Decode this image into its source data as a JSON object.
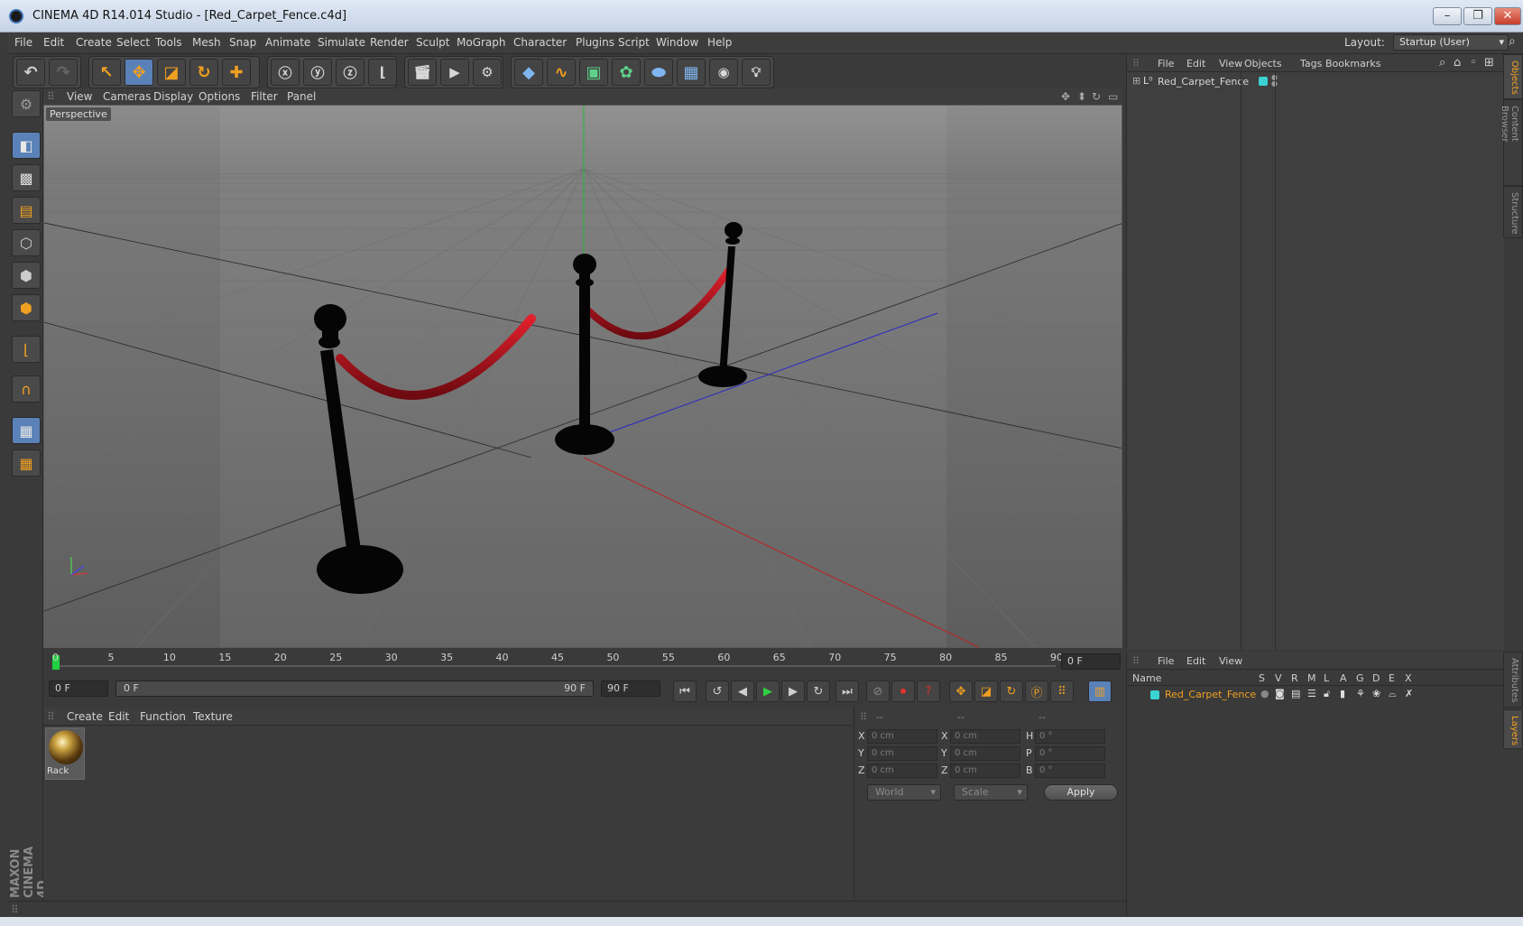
{
  "window": {
    "title": "CINEMA 4D R14.014 Studio - [Red_Carpet_Fence.c4d]"
  },
  "menubar": {
    "items": [
      "File",
      "Edit",
      "Create",
      "Select",
      "Tools",
      "Mesh",
      "Snap",
      "Animate",
      "Simulate",
      "Render",
      "Sculpt",
      "MoGraph",
      "Character",
      "Plugins",
      "Script",
      "Window",
      "Help"
    ],
    "layout_label": "Layout:",
    "layout_value": "Startup (User)"
  },
  "viewport": {
    "menu": [
      "View",
      "Cameras",
      "Display",
      "Options",
      "Filter",
      "Panel"
    ],
    "label": "Perspective"
  },
  "timeline": {
    "ticks": [
      "0",
      "5",
      "10",
      "15",
      "20",
      "25",
      "30",
      "35",
      "40",
      "45",
      "50",
      "55",
      "60",
      "65",
      "70",
      "75",
      "80",
      "85",
      "90"
    ],
    "current_frame": "0 F",
    "start_field": "0 F",
    "range_start": "0 F",
    "range_end": "90 F",
    "end_field": "90 F"
  },
  "materials": {
    "menu": [
      "Create",
      "Edit",
      "Function",
      "Texture"
    ],
    "items": [
      {
        "name": "Rack"
      }
    ]
  },
  "coordinates": {
    "headers": [
      "--",
      "--",
      "--"
    ],
    "rows": [
      {
        "a": "X",
        "av": "0 cm",
        "b": "X",
        "bv": "0 cm",
        "c": "H",
        "cv": "0 °"
      },
      {
        "a": "Y",
        "av": "0 cm",
        "b": "Y",
        "bv": "0 cm",
        "c": "P",
        "cv": "0 °"
      },
      {
        "a": "Z",
        "av": "0 cm",
        "b": "Z",
        "bv": "0 cm",
        "c": "B",
        "cv": "0 °"
      }
    ],
    "mode1": "World",
    "mode2": "Scale",
    "apply": "Apply"
  },
  "objects": {
    "menu": [
      "File",
      "Edit",
      "View",
      "Objects",
      "Tags",
      "Bookmarks"
    ],
    "items": [
      {
        "name": "Red_Carpet_Fence"
      }
    ]
  },
  "layers": {
    "menu": [
      "File",
      "Edit",
      "View"
    ],
    "columns": [
      "Name",
      "S",
      "V",
      "R",
      "M",
      "L",
      "A",
      "G",
      "D",
      "E",
      "X"
    ],
    "items": [
      {
        "name": "Red_Carpet_Fence"
      }
    ]
  },
  "sidetabs": {
    "top": [
      "Objects",
      "Content Browser",
      "Structure"
    ],
    "bottom": [
      "Attributes",
      "Layers"
    ]
  },
  "branding": {
    "logo": "MAXON CINEMA 4D"
  },
  "colors": {
    "accent": "#f0a020",
    "selection": "#5a82b8",
    "rope": "#b3101a",
    "layer_color": "#3ad2d2"
  }
}
